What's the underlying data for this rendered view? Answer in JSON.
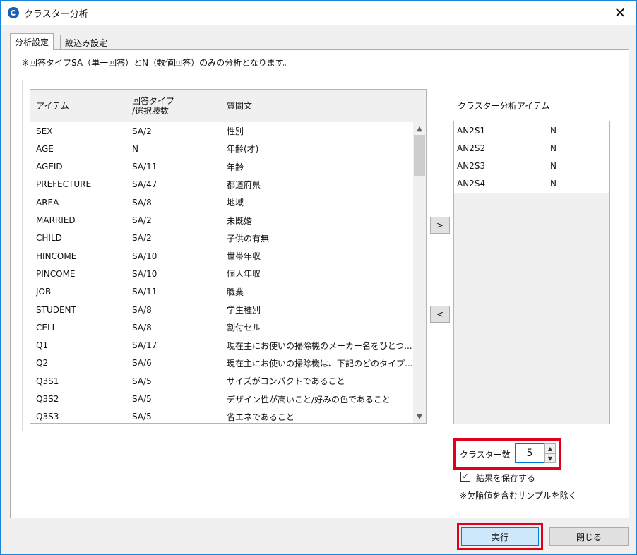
{
  "window": {
    "title": "クラスター分析",
    "close_label": "✕"
  },
  "tabs": [
    {
      "label": "分析設定",
      "active": true
    },
    {
      "label": "絞込み設定",
      "active": false
    }
  ],
  "notice": "※回答タイプSA（単一回答）とN（数値回答）のみの分析となります。",
  "item_list": {
    "headers": {
      "item": "アイテム",
      "type": "回答タイプ\n/選択肢数",
      "question": "質問文"
    },
    "rows": [
      {
        "item": "SEX",
        "type": "SA/2",
        "question": "性別"
      },
      {
        "item": "AGE",
        "type": "N",
        "question": "年齢(才)"
      },
      {
        "item": "AGEID",
        "type": "SA/11",
        "question": "年齢"
      },
      {
        "item": "PREFECTURE",
        "type": "SA/47",
        "question": "都道府県"
      },
      {
        "item": "AREA",
        "type": "SA/8",
        "question": "地域"
      },
      {
        "item": "MARRIED",
        "type": "SA/2",
        "question": "未既婚"
      },
      {
        "item": "CHILD",
        "type": "SA/2",
        "question": "子供の有無"
      },
      {
        "item": "HINCOME",
        "type": "SA/10",
        "question": "世帯年収"
      },
      {
        "item": "PINCOME",
        "type": "SA/10",
        "question": "個人年収"
      },
      {
        "item": "JOB",
        "type": "SA/11",
        "question": "職業"
      },
      {
        "item": "STUDENT",
        "type": "SA/8",
        "question": "学生種別"
      },
      {
        "item": "CELL",
        "type": "SA/8",
        "question": "割付セル"
      },
      {
        "item": "Q1",
        "type": "SA/17",
        "question": "現在主にお使いの掃除機のメーカー名をひとつ..."
      },
      {
        "item": "Q2",
        "type": "SA/6",
        "question": "現在主にお使いの掃除機は、下記のどのタイプ..."
      },
      {
        "item": "Q3S1",
        "type": "SA/5",
        "question": "サイズがコンパクトであること"
      },
      {
        "item": "Q3S2",
        "type": "SA/5",
        "question": "デザイン性が高いこと/好みの色であること"
      },
      {
        "item": "Q3S3",
        "type": "SA/5",
        "question": "省エネであること"
      }
    ]
  },
  "move_buttons": {
    "add": ">",
    "remove": "<"
  },
  "cluster_items": {
    "label": "クラスター分析アイテム",
    "rows": [
      {
        "item": "AN2S1",
        "type": "N"
      },
      {
        "item": "AN2S2",
        "type": "N"
      },
      {
        "item": "AN2S3",
        "type": "N"
      },
      {
        "item": "AN2S4",
        "type": "N"
      }
    ]
  },
  "cluster_count": {
    "label": "クラスター数",
    "value": "5"
  },
  "save_result": {
    "label": "結果を保存する",
    "checked": true
  },
  "exclusion_note": "※欠陥値を含むサンプルを除く",
  "buttons": {
    "run": "実行",
    "close": "閉じる"
  },
  "colors": {
    "highlight": "#e0001b",
    "run_button": "#cce8fa",
    "accent": "#0078d7"
  }
}
